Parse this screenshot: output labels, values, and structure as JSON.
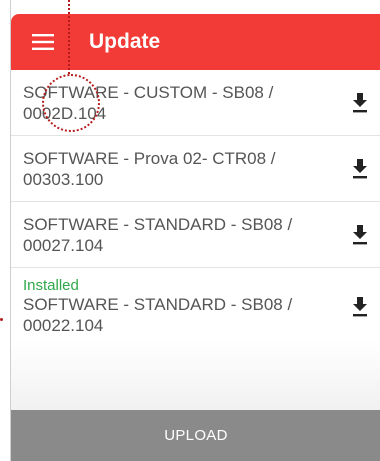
{
  "app": {
    "title": "Update",
    "accent_color": "#f23a36",
    "menu_icon": "menu-icon"
  },
  "software_list": [
    {
      "status": "",
      "title": "SOFTWARE - CUSTOM - SB08 / 0002D.104",
      "action_icon": "download-icon"
    },
    {
      "status": "",
      "title": "SOFTWARE - Prova 02- CTR08 / 00303.100",
      "action_icon": "download-icon"
    },
    {
      "status": "",
      "title": "SOFTWARE - STANDARD - SB08 / 00027.104",
      "action_icon": "download-icon"
    },
    {
      "status": "Installed",
      "title": "SOFTWARE - STANDARD - SB08 / 00022.104",
      "action_icon": "download-icon"
    }
  ],
  "footer": {
    "upload_label": "UPLOAD"
  }
}
